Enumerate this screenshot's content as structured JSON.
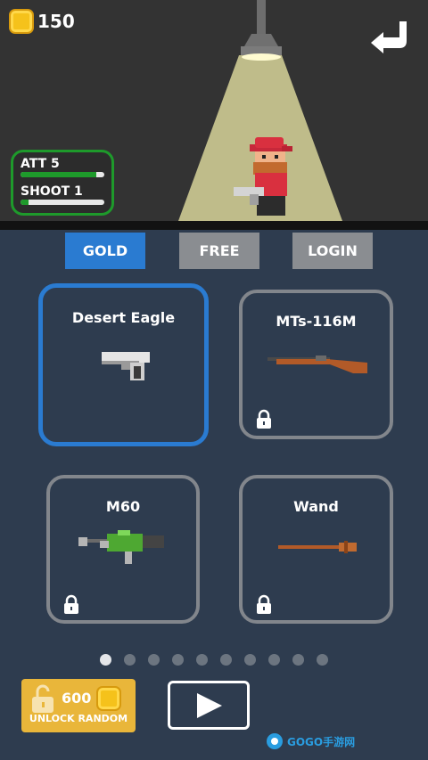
{
  "header": {
    "coins": "150",
    "coin_icon": "coin-icon",
    "back_icon": "return-arrow-icon"
  },
  "stats": {
    "att_label": "ATT 5",
    "att_level": 0.9,
    "shoot_label": "SHOOT 1",
    "shoot_level": 0.1
  },
  "tabs": [
    {
      "label": "GOLD",
      "active": true
    },
    {
      "label": "FREE",
      "active": false
    },
    {
      "label": "LOGIN",
      "active": false
    }
  ],
  "weapons": [
    {
      "name": "Desert Eagle",
      "locked": false,
      "selected": true
    },
    {
      "name": "MTs-116M",
      "locked": true,
      "selected": false
    },
    {
      "name": "M60",
      "locked": true,
      "selected": false
    },
    {
      "name": "Wand",
      "locked": true,
      "selected": false
    }
  ],
  "pager": {
    "total": 10,
    "current": 1
  },
  "unlock": {
    "price": "600",
    "label": "UNLOCK RANDOM"
  },
  "watermark": {
    "text": "GOGO手游网"
  },
  "colors": {
    "accent_blue": "#2a7bd1",
    "tab_inactive": "#8a8d91",
    "stats_border": "#1e9a2b",
    "gold": "#e9b63a",
    "background": "#2e3c4f"
  }
}
